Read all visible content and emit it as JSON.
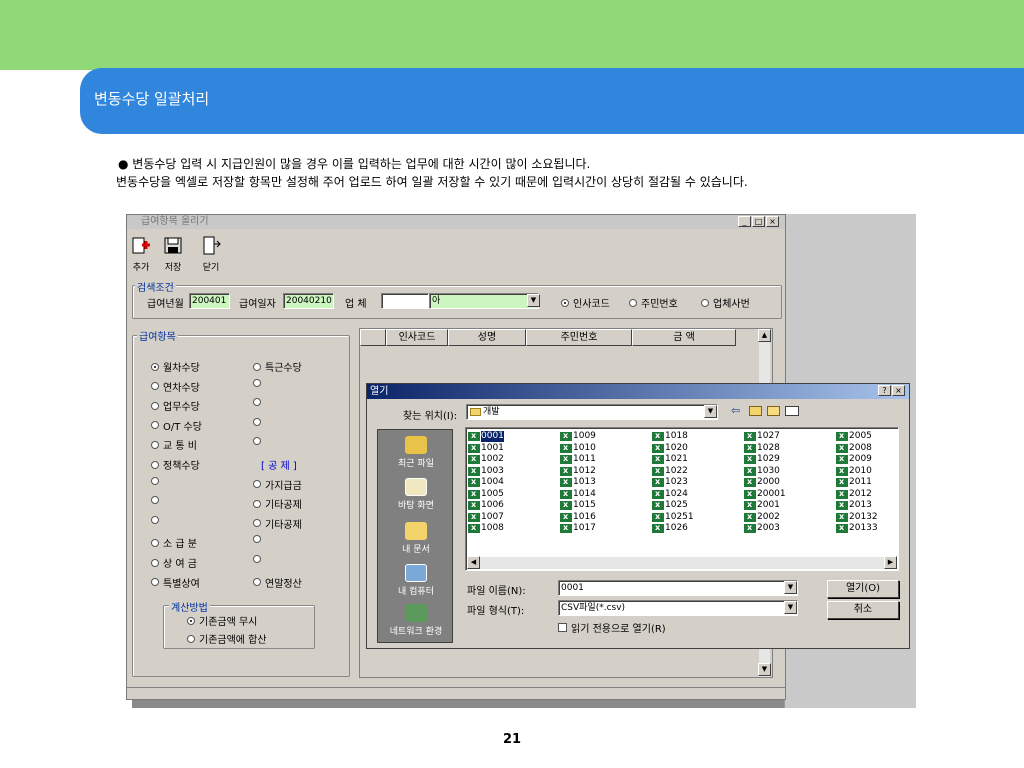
{
  "slide": {
    "title": "변동수당 일괄처리",
    "bullet_line1": "●  변동수당 입력 시 지급인원이 많을 경우 이를 입력하는 업무에 대한 시간이 많이 소요됩니다.",
    "bullet_line2": "변동수당을 엑셀로 저장할 항목만 설정해 주어 업로드 하여 일괄 저장할 수 있기 때문에 입력시간이 상당히 절감될 수 있습니다.",
    "page_number": "21"
  },
  "window": {
    "title": "급여항목 올리기",
    "controls": [
      "_",
      "□",
      "×"
    ],
    "toolbar": [
      {
        "label": "추가",
        "icon": "add-icon"
      },
      {
        "label": "저장",
        "icon": "save-icon"
      },
      {
        "label": "닫기",
        "icon": "close-door-icon"
      }
    ],
    "search": {
      "group_label": "검색조건",
      "pay_month_label": "급여년월",
      "pay_month_value": "200401",
      "pay_date_label": "급여일자",
      "pay_date_value": "20040210",
      "company_label": "업 체",
      "company_value": "아",
      "radio_options": [
        {
          "label": "인사코드",
          "selected": true
        },
        {
          "label": "주민번호",
          "selected": false
        },
        {
          "label": "업체사번",
          "selected": false
        }
      ]
    },
    "items_group": {
      "label": "급여항목",
      "left_options": [
        {
          "label": "월차수당",
          "selected": true
        },
        {
          "label": "연차수당",
          "selected": false
        },
        {
          "label": "업무수당",
          "selected": false
        },
        {
          "label": "O/T 수당",
          "selected": false
        },
        {
          "label": "교 통 비",
          "selected": false
        },
        {
          "label": "정책수당",
          "selected": false
        },
        {
          "label": "",
          "selected": false
        },
        {
          "label": "",
          "selected": false
        },
        {
          "label": "",
          "selected": false
        },
        {
          "label": "소 급 분",
          "selected": false
        },
        {
          "label": "상 여 금",
          "selected": false
        },
        {
          "label": "특별상여",
          "selected": false
        }
      ],
      "right_options": [
        {
          "label": "특근수당"
        },
        {
          "label": ""
        },
        {
          "label": ""
        },
        {
          "label": ""
        },
        {
          "label": ""
        },
        {
          "label": "[ 공 제 ]",
          "header": true
        },
        {
          "label": "가지급금"
        },
        {
          "label": "기타공제"
        },
        {
          "label": "기타공제"
        },
        {
          "label": ""
        },
        {
          "label": ""
        },
        {
          "label": "연말정산"
        }
      ],
      "calc_group": {
        "label": "계산방법",
        "options": [
          {
            "label": "기존금액 무시",
            "selected": true
          },
          {
            "label": "기존금액에 합산",
            "selected": false
          }
        ]
      }
    },
    "grid": {
      "columns": [
        "",
        "인사코드",
        "성명",
        "주민번호",
        "금 액"
      ]
    }
  },
  "dialog": {
    "title": "열기",
    "title_buttons": [
      "?",
      "×"
    ],
    "look_in_label": "찾는 위치(I):",
    "look_in_value": "개발",
    "places": [
      "최근 파일",
      "바탕 화면",
      "내 문서",
      "내 컴퓨터",
      "네트워크 환경"
    ],
    "files": [
      [
        "0001",
        "1001",
        "1002",
        "1003",
        "1004",
        "1005",
        "1006",
        "1007",
        "1008"
      ],
      [
        "1009",
        "1010",
        "1011",
        "1012",
        "1013",
        "1014",
        "1015",
        "1016",
        "1017"
      ],
      [
        "1018",
        "1020",
        "1021",
        "1022",
        "1023",
        "1024",
        "1025",
        "10251",
        "1026"
      ],
      [
        "1027",
        "1028",
        "1029",
        "1030",
        "2000",
        "20001",
        "2001",
        "2002",
        "2003"
      ],
      [
        "2005",
        "2008",
        "2009",
        "2010",
        "2011",
        "2012",
        "2013",
        "20132",
        "20133"
      ]
    ],
    "selected_file": "0001",
    "filename_label": "파일 이름(N):",
    "filename_value": "0001",
    "filetype_label": "파일 형식(T):",
    "filetype_value": "CSV파일(*.csv)",
    "readonly_label": "읽기 전용으로 열기(R)",
    "open_button": "열기(O)",
    "cancel_button": "취소"
  }
}
